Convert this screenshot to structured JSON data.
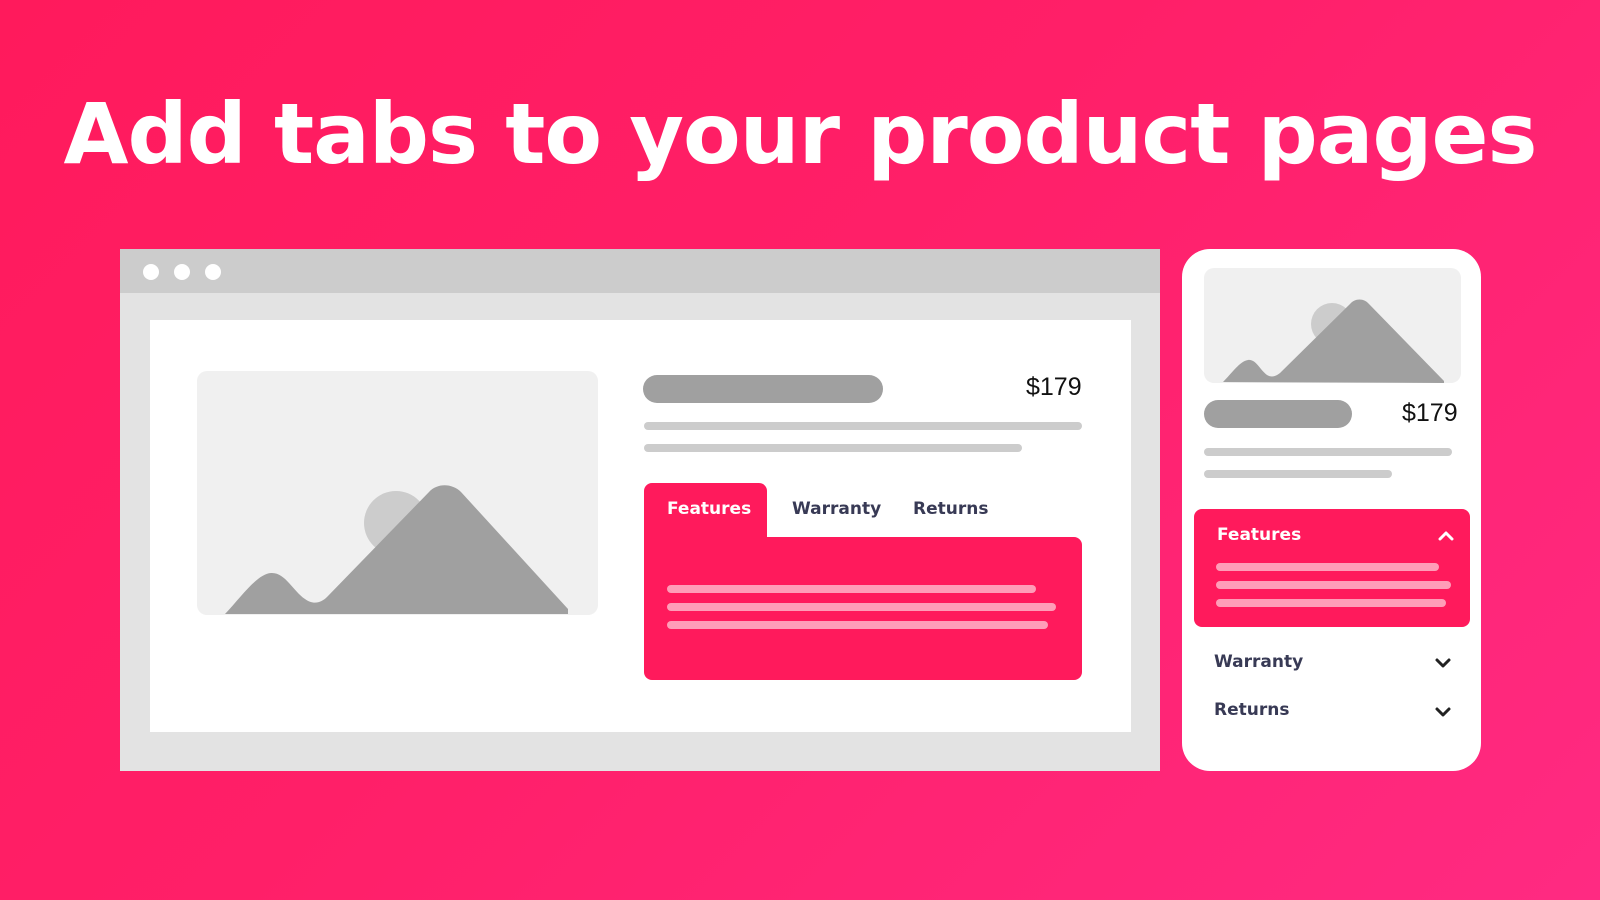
{
  "headline": "Add tabs to your product pages",
  "colors": {
    "background_start": "#ff1a5c",
    "background_end": "#ff2a82",
    "accent": "#ff1a5c",
    "accent_light_lines": "#ff9db8",
    "placeholder_dark": "#a0a0a0",
    "placeholder_light": "#cccccc",
    "image_bg": "#f0f0f0",
    "tab_text": "#383a55"
  },
  "desktop": {
    "window_controls": [
      "dot",
      "dot",
      "dot"
    ],
    "product": {
      "image_icon": "image-placeholder-icon",
      "price": "$179"
    },
    "tabs": [
      {
        "label": "Features",
        "active": true
      },
      {
        "label": "Warranty",
        "active": false
      },
      {
        "label": "Returns",
        "active": false
      }
    ]
  },
  "mobile": {
    "product": {
      "image_icon": "image-placeholder-icon",
      "price": "$179"
    },
    "accordion": [
      {
        "label": "Features",
        "expanded": true,
        "icon": "chevron-up-icon"
      },
      {
        "label": "Warranty",
        "expanded": false,
        "icon": "chevron-down-icon"
      },
      {
        "label": "Returns",
        "expanded": false,
        "icon": "chevron-down-icon"
      }
    ]
  }
}
